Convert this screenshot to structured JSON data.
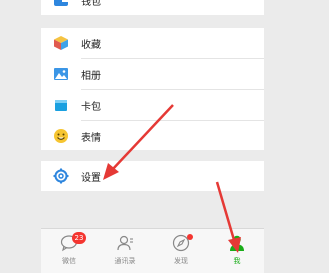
{
  "menu": {
    "wallet_label": "钱包",
    "favorites_label": "收藏",
    "album_label": "相册",
    "cards_label": "卡包",
    "stickers_label": "表情",
    "settings_label": "设置"
  },
  "tabbar": {
    "chats_label": "微信",
    "chats_badge": "23",
    "contacts_label": "通讯录",
    "discover_label": "发现",
    "me_label": "我"
  },
  "colors": {
    "accent_green": "#1aad19",
    "badge_red": "#f43530",
    "annotation_red": "#e53935"
  }
}
